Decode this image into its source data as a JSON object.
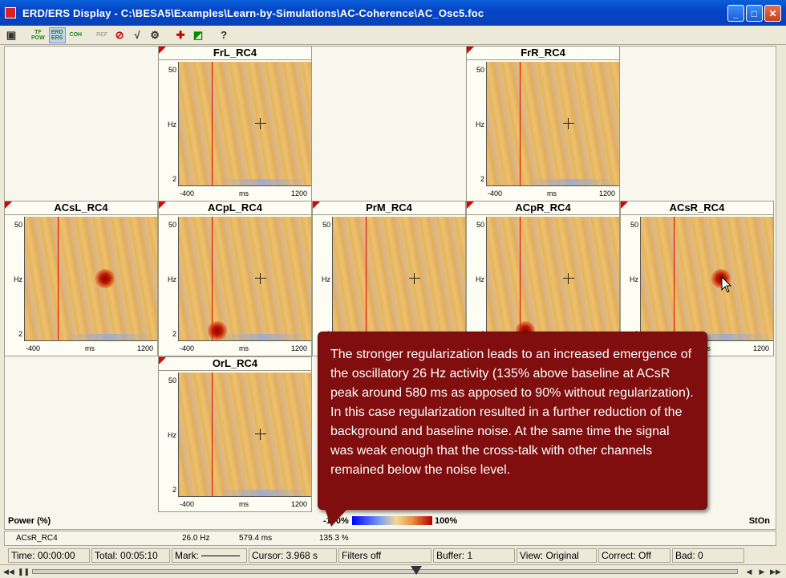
{
  "window": {
    "title": "ERD/ERS Display  -  C:\\BESA5\\Examples\\Learn-by-Simulations\\AC-Coherence\\AC_Osc5.foc"
  },
  "toolbar": {
    "buttons": [
      {
        "name": "save",
        "label": ""
      },
      {
        "name": "tf-pow",
        "label": "TF\nPOW"
      },
      {
        "name": "erd-ers",
        "label": "ERD\nERS"
      },
      {
        "name": "coh",
        "label": "COH"
      },
      {
        "name": "ref",
        "label": "REF"
      }
    ],
    "help_label": "?"
  },
  "panels": [
    {
      "id": "frl",
      "title": "FrL_RC4",
      "blob": null
    },
    {
      "id": "frr",
      "title": "FrR_RC4",
      "blob": null
    },
    {
      "id": "acsl",
      "title": "ACsL_RC4",
      "blob": "center"
    },
    {
      "id": "acpl",
      "title": "ACpL_RC4",
      "blob": "low"
    },
    {
      "id": "prm",
      "title": "PrM_RC4",
      "blob": null
    },
    {
      "id": "acpr",
      "title": "ACpR_RC4",
      "blob": "low"
    },
    {
      "id": "acsr",
      "title": "ACsR_RC4",
      "blob": "center"
    },
    {
      "id": "orl",
      "title": "OrL_RC4",
      "blob": null
    }
  ],
  "axis": {
    "y_top": "50",
    "y_mid": "Hz",
    "y_bottom": "2",
    "x_left": "-400",
    "x_mid": "ms",
    "x_right": "1200"
  },
  "legend": {
    "power_label": "Power (%)",
    "min_label": "-100%",
    "max_label": "100%",
    "ston_label": "StOn"
  },
  "info": {
    "channel": "ACsR_RC4",
    "freq": "26.0 Hz",
    "time": "579.4 ms",
    "value": "135.3 %"
  },
  "status": {
    "time": "Time: 00:00:00",
    "total": "Total: 00:05:10",
    "mark": "Mark:",
    "cursor": "Cursor: 3.968 s",
    "filters": "Filters off",
    "buffer": "Buffer: 1",
    "view": "View: Original",
    "correct": "Correct: Off",
    "bad": "Bad: 0"
  },
  "callout": {
    "text": "The stronger regularization leads to an increased emergence of the oscillatory 26 Hz activity (135% above baseline at ACsR peak around 580 ms as apposed to 90% without regularization). In this case regularization resulted in a further reduction of the background and baseline noise. At the same time the signal was weak enough that the cross-talk with other channels remained below the noise level."
  },
  "colors": {
    "title_bar": "#0545c8",
    "callout_bg": "#800e0e",
    "corner_marker": "#e00000"
  }
}
